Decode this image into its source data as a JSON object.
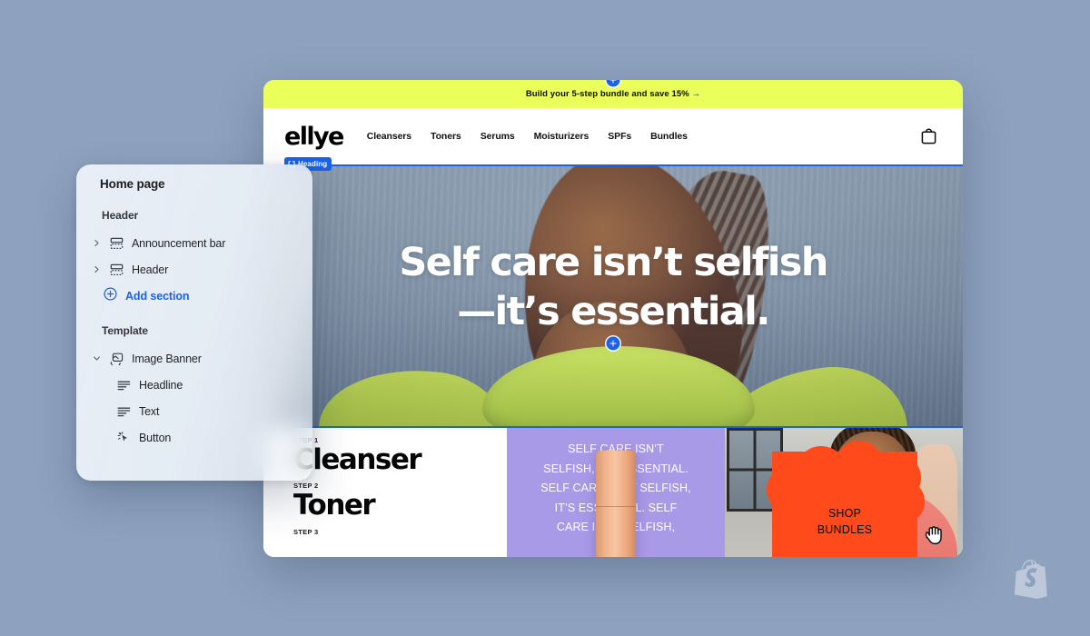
{
  "background_color": "#8ea2bf",
  "accent_color": "#1a62e8",
  "sidebar": {
    "title": "Home page",
    "groups": [
      {
        "label": "Header",
        "rows": [
          {
            "label": "Announcement bar",
            "icon": "section-icon",
            "chevron": "chevron-right-icon"
          },
          {
            "label": "Header",
            "icon": "section-icon",
            "chevron": "chevron-right-icon"
          }
        ],
        "add_label": "Add section",
        "add_icon": "circle-plus-icon"
      },
      {
        "label": "Template",
        "rows": [
          {
            "label": "Image Banner",
            "icon": "image-banner-icon",
            "chevron": "chevron-down-icon"
          },
          {
            "label": "Headline",
            "icon": "text-lines-icon",
            "child": true
          },
          {
            "label": "Text",
            "icon": "text-lines-icon",
            "child": true
          },
          {
            "label": "Button",
            "icon": "button-cursor-icon",
            "child": true
          }
        ]
      }
    ]
  },
  "preview": {
    "announcement": {
      "text": "Build your 5-step bundle and save 15% →",
      "background": "#eaff5a"
    },
    "header": {
      "logo": "ellye",
      "nav": [
        "Cleansers",
        "Toners",
        "Serums",
        "Moisturizers",
        "SPFs",
        "Bundles"
      ],
      "cart_icon": "shopping-bag-icon"
    },
    "selection_badge": {
      "label": "Heading",
      "icon": "heading-marker-icon",
      "color": "#1a62e8"
    },
    "hero": {
      "line1": "Self care isn’t selfish",
      "line2": "—it’s essential.",
      "add_handle_icon": "circle-plus-handle-icon",
      "cursor_icon": "grabbing-hand-cursor-icon"
    },
    "strip": {
      "steps": [
        {
          "step": "STEP 1",
          "name": "Cleanser"
        },
        {
          "step": "STEP 2",
          "name": "Toner"
        },
        {
          "step": "STEP 3",
          "name": ""
        }
      ],
      "purple_card": {
        "marquee": "SELF CARE ISN’T\nSELFISH, IT’S ESSENTIAL.\nSELF CARE ISN’T SELFISH,\nIT’S ESSENTIAL. SELF\nCARE ISN’T SELFISH,",
        "background": "#a99ae8",
        "product_icon": "product-tube-icon"
      },
      "bundle_card": {
        "cta_line1": "SHOP",
        "cta_line2": "BUNDLES",
        "blob_color": "#ff4a1c"
      }
    }
  },
  "watermark": {
    "icon": "shopify-bag-logo"
  }
}
